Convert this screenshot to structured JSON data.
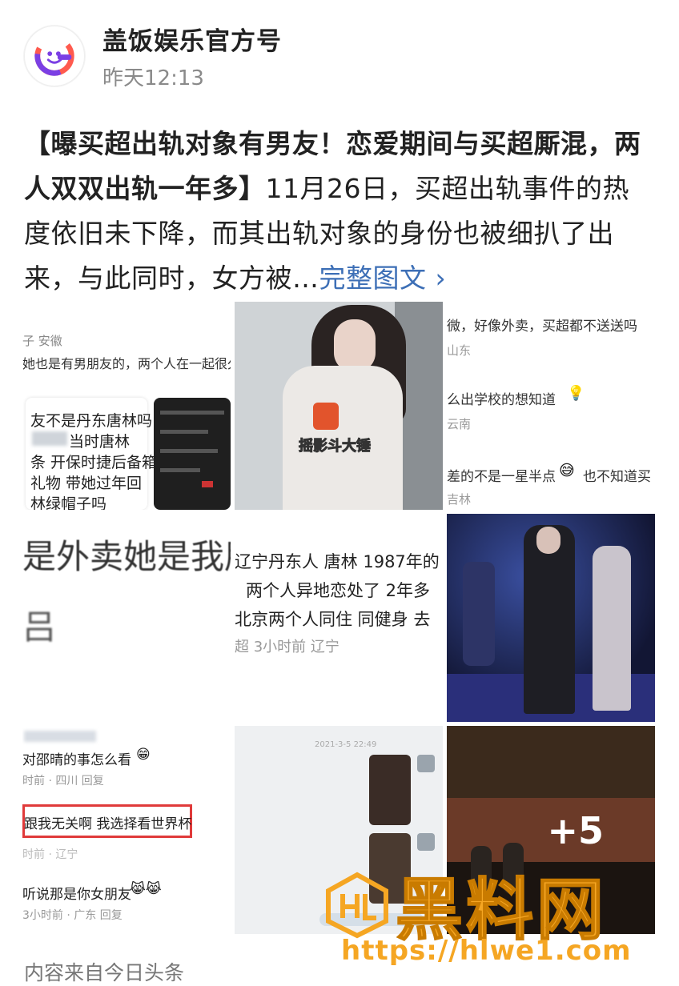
{
  "author": {
    "name": "盖饭娱乐官方号",
    "time": "昨天12:13"
  },
  "post": {
    "headline": "【曝买超出轨对象有男友！恋爱期间与买超厮混，两人双双出轨一年多】",
    "body": "11月26日，买超出轨事件的热度依旧未下降，而其出轨对象的身份也被细扒了出来，与此同时，女方被…",
    "more_link": "完整图文 ›"
  },
  "grid": {
    "tile1": {
      "lines": [
        "子 安徽",
        "她也是有男朋友的，两个人在一起很久了",
        "友不是丹东唐林吗",
        "当时唐林",
        "条 开保时捷后备箱",
        "礼物 带她过年回",
        "林绿帽子吗"
      ]
    },
    "tile2": {
      "overlay": "摇影斗大锤"
    },
    "tile3": {
      "lines": [
        "微，好像外卖，买超都不送送吗",
        "山东",
        "么出学校的想知道",
        "云南",
        "差的不是一星半点",
        "也不知道买",
        "吉林"
      ]
    },
    "tile4": {
      "lines": [
        "是外卖她是我朋",
        "吕"
      ]
    },
    "tile5": {
      "lines": [
        "辽宁丹东人  唐林 1987年的",
        "两个人异地恋处了 2年多",
        "北京两个人同住  同健身  去",
        "超  3小时前  辽宁"
      ]
    },
    "tile7": {
      "lines": [
        "对邵晴的事怎么看",
        "时前 · 四川    回复",
        "跟我无关啊 我选择看世界杯",
        "时前 · 辽宁",
        "听说那是你女朋友",
        "3小时前 · 广东    回复"
      ]
    },
    "tile8": {
      "lines": [
        "2021-3-5 22:49"
      ]
    },
    "tile9": {
      "more_count": "+5"
    }
  },
  "watermark": {
    "brand": "黑料网",
    "url": "https://hlwe1.com"
  },
  "footer": {
    "source": "内容来自今日头条"
  },
  "colors": {
    "link": "#3d6fb6",
    "watermark": "#f5a623",
    "highlight_box": "#e03a3a"
  }
}
